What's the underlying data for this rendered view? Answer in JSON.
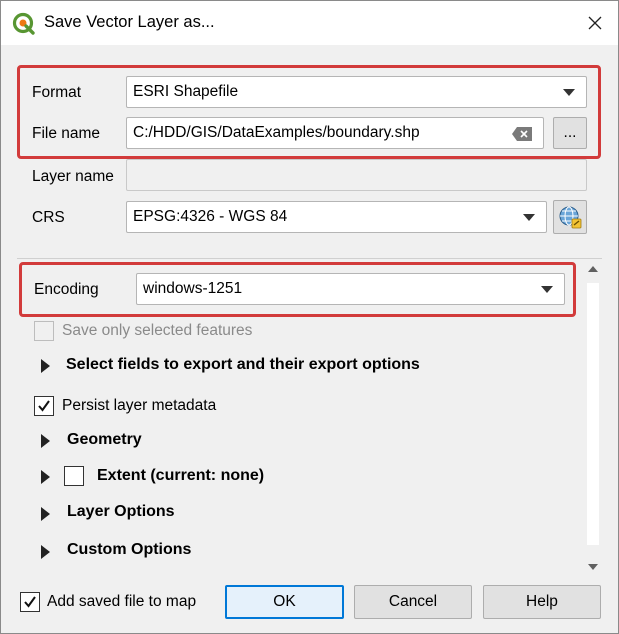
{
  "window": {
    "title": "Save Vector Layer as..."
  },
  "form": {
    "format_label": "Format",
    "format_value": "ESRI Shapefile",
    "filename_label": "File name",
    "filename_value": "C:/HDD/GIS/DataExamples/boundary.shp",
    "browse_label": "...",
    "layername_label": "Layer name",
    "layername_value": "",
    "crs_label": "CRS",
    "crs_value": "EPSG:4326 - WGS 84",
    "encoding_label": "Encoding",
    "encoding_value": "windows-1251"
  },
  "options": {
    "save_selected": "Save only selected features",
    "select_fields": "Select fields to export and their export options",
    "persist_metadata": "Persist layer metadata",
    "geometry": "Geometry",
    "extent": "Extent (current: none)",
    "layer_options": "Layer Options",
    "custom_options": "Custom Options"
  },
  "footer": {
    "add_to_map": "Add saved file to map",
    "ok": "OK",
    "cancel": "Cancel",
    "help": "Help"
  },
  "colors": {
    "highlight": "#d23b3b",
    "accent": "#0078d7"
  },
  "icons": [
    "qgis-logo-icon",
    "close-icon",
    "clear-icon",
    "globe-crs-icon",
    "chevron-down-icon",
    "expand-arrow-icon",
    "checkmark-icon"
  ]
}
